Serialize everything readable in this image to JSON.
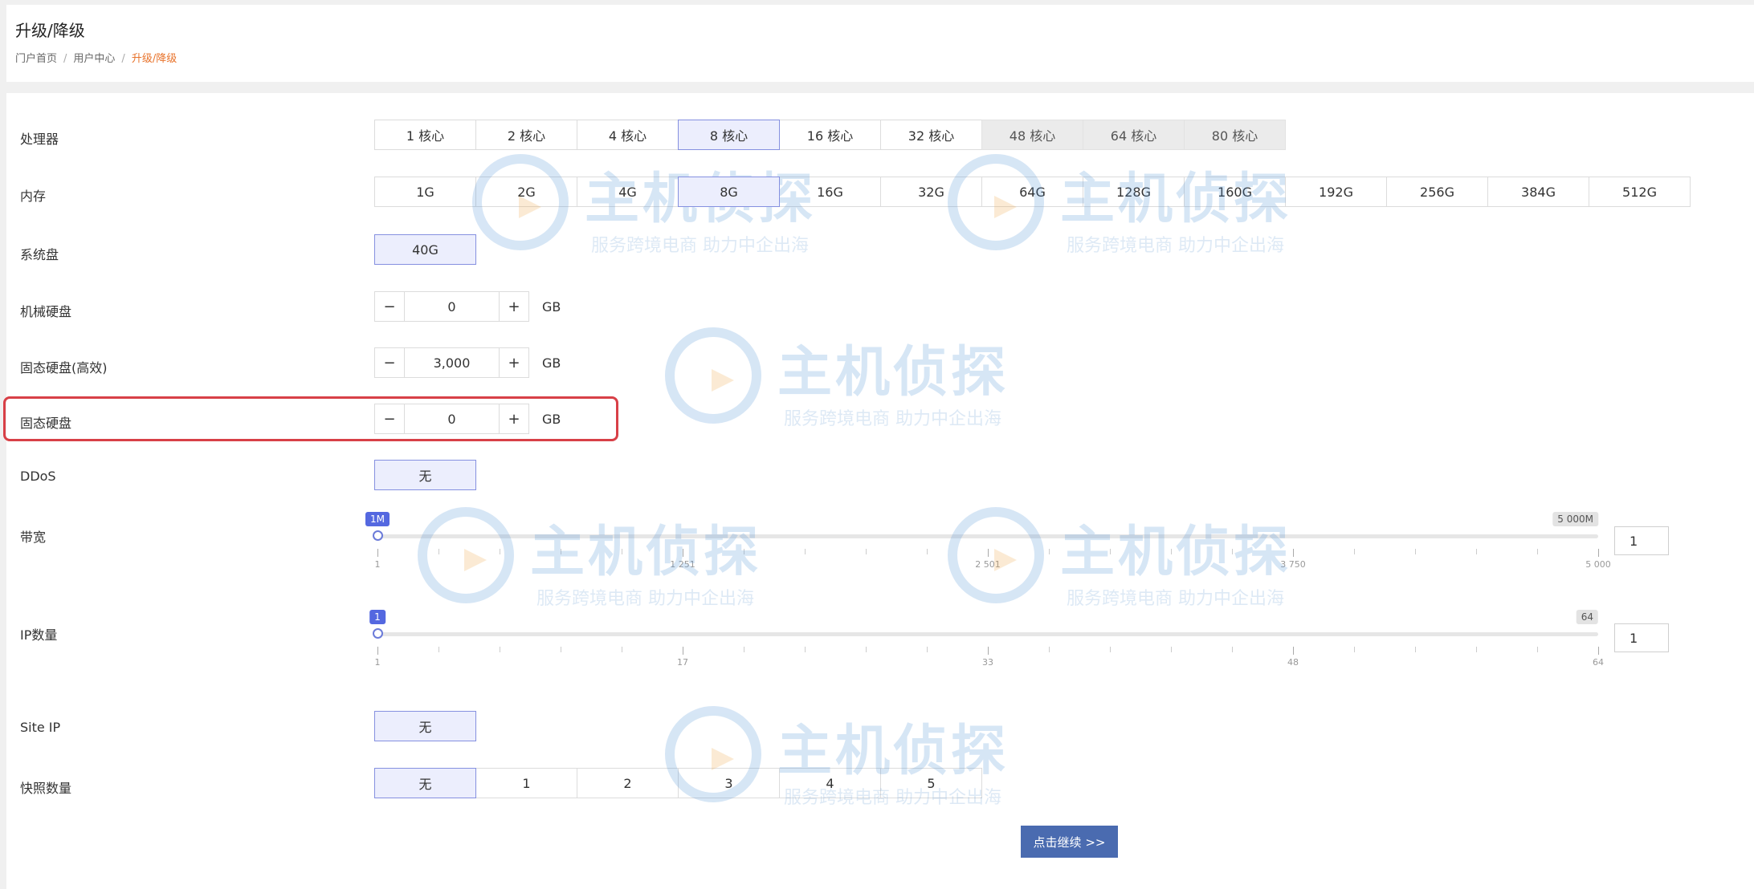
{
  "header": {
    "title": "升级/降级",
    "breadcrumb": [
      "门户首页",
      "用户中心",
      "升级/降级"
    ]
  },
  "rows": {
    "cpu": {
      "label": "处理器",
      "options": [
        "1 核心",
        "2 核心",
        "4 核心",
        "8 核心",
        "16 核心",
        "32 核心",
        "48 核心",
        "64 核心",
        "80 核心"
      ],
      "selected": "8 核心",
      "disabled": [
        "48 核心",
        "64 核心",
        "80 核心"
      ]
    },
    "memory": {
      "label": "内存",
      "options": [
        "1G",
        "2G",
        "4G",
        "8G",
        "16G",
        "32G",
        "64G",
        "128G",
        "160G",
        "192G",
        "256G",
        "384G",
        "512G"
      ],
      "selected": "8G"
    },
    "system_disk": {
      "label": "系统盘",
      "options": [
        "40G"
      ],
      "selected": "40G"
    },
    "hdd": {
      "label": "机械硬盘",
      "value": "0",
      "unit": "GB"
    },
    "ssd_high": {
      "label": "固态硬盘(高效)",
      "value": "3,000",
      "unit": "GB"
    },
    "ssd": {
      "label": "固态硬盘",
      "value": "0",
      "unit": "GB"
    },
    "ddos": {
      "label": "DDoS",
      "options": [
        "无"
      ],
      "selected": "无"
    },
    "bandwidth": {
      "label": "带宽",
      "current_label": "1M",
      "max_label": "5 000M",
      "ticks": [
        "1",
        "1 251",
        "2 501",
        "3 750",
        "5 000"
      ],
      "value": "1",
      "fraction": 0
    },
    "ip_count": {
      "label": "IP数量",
      "current_label": "1",
      "max_label": "64",
      "ticks": [
        "1",
        "17",
        "33",
        "48",
        "64"
      ],
      "value": "1",
      "fraction": 0
    },
    "site_ip": {
      "label": "Site IP",
      "options": [
        "无"
      ],
      "selected": "无"
    },
    "snapshots": {
      "label": "快照数量",
      "options": [
        "无",
        "1",
        "2",
        "3",
        "4",
        "5"
      ],
      "selected": "无"
    }
  },
  "continue_button": "点击继续 >>",
  "watermark": {
    "title": "主机侦探",
    "subtitle": "服务跨境电商 助力中企出海"
  },
  "colors": {
    "accent": "#5468e0",
    "selected_bg": "#eceefd",
    "button": "#4a6bb0",
    "highlight_border": "#d84047",
    "breadcrumb_active": "#e8732b"
  }
}
